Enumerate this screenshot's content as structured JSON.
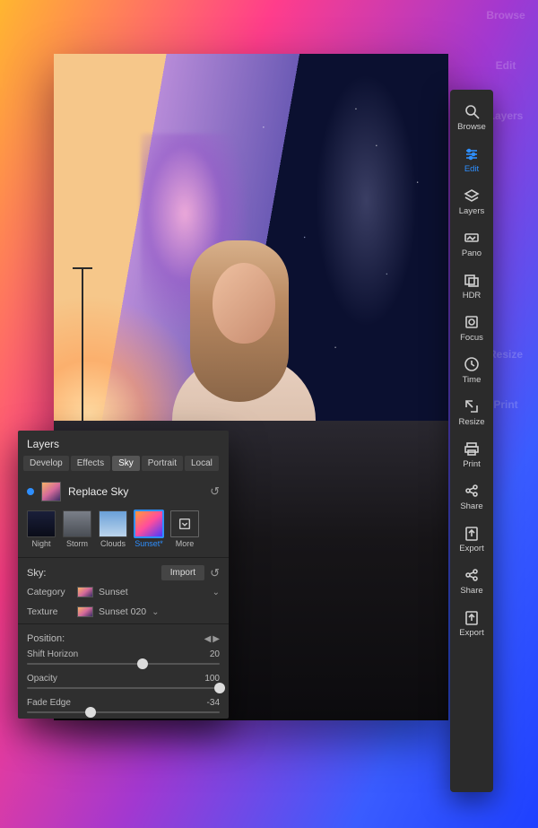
{
  "bg_sidebar": [
    "Browse",
    "Edit",
    "Layers",
    "",
    "",
    "",
    "",
    "",
    "Resize",
    "Print"
  ],
  "sidebar": {
    "items": [
      {
        "label": "Browse",
        "icon": "browse"
      },
      {
        "label": "Edit",
        "icon": "edit",
        "active": true
      },
      {
        "label": "Layers",
        "icon": "layers"
      },
      {
        "label": "Pano",
        "icon": "pano"
      },
      {
        "label": "HDR",
        "icon": "hdr"
      },
      {
        "label": "Focus",
        "icon": "focus"
      },
      {
        "label": "Time",
        "icon": "time"
      },
      {
        "label": "Resize",
        "icon": "resize"
      },
      {
        "label": "Print",
        "icon": "print"
      },
      {
        "label": "Share",
        "icon": "share"
      },
      {
        "label": "Export",
        "icon": "export"
      },
      {
        "label": "Share",
        "icon": "share"
      },
      {
        "label": "Export",
        "icon": "export"
      }
    ]
  },
  "panel": {
    "title": "Layers",
    "tabs": [
      "Develop",
      "Effects",
      "Sky",
      "Portrait",
      "Local"
    ],
    "active_tab": "Sky",
    "filter_name": "Replace Sky",
    "presets": [
      {
        "label": "Night",
        "key": "night"
      },
      {
        "label": "Storm",
        "key": "storm"
      },
      {
        "label": "Clouds",
        "key": "clouds"
      },
      {
        "label": "Sunset*",
        "key": "sunset",
        "active": true
      },
      {
        "label": "More",
        "key": "more"
      }
    ],
    "sky_section_label": "Sky:",
    "import_btn": "Import",
    "category_label": "Category",
    "category_value": "Sunset",
    "texture_label": "Texture",
    "texture_value": "Sunset 020",
    "position_label": "Position:",
    "sliders": [
      {
        "label": "Shift Horizon",
        "value": 20,
        "min": -100,
        "max": 100
      },
      {
        "label": "Opacity",
        "value": 100,
        "min": 0,
        "max": 100
      },
      {
        "label": "Fade Edge",
        "value": -34,
        "min": -100,
        "max": 100
      }
    ]
  }
}
